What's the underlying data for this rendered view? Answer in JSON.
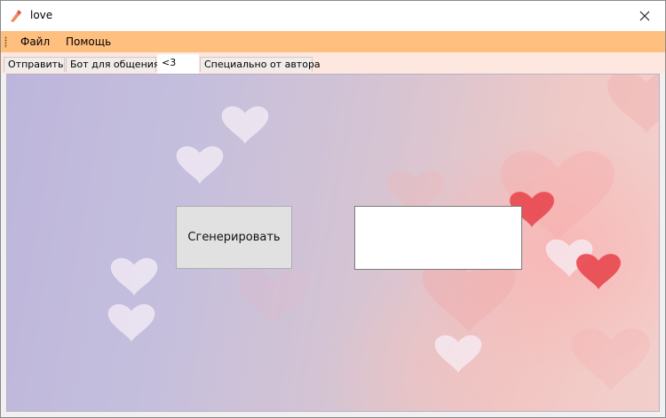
{
  "window": {
    "title": "love"
  },
  "menu": {
    "items": [
      "Файл",
      "Помощь"
    ]
  },
  "tabs": [
    {
      "label": "Отправить",
      "active": false
    },
    {
      "label": "Бот для общения",
      "active": false
    },
    {
      "label": "<3",
      "active": true
    },
    {
      "label": "Специально от автора",
      "active": false
    }
  ],
  "content": {
    "generate_button": "Сгенерировать",
    "output_value": ""
  },
  "colors": {
    "menubar": "#ffbf7f",
    "tabstrip": "#fde7df",
    "heart_red": "#e8474f",
    "heart_white": "#f5eef5"
  }
}
